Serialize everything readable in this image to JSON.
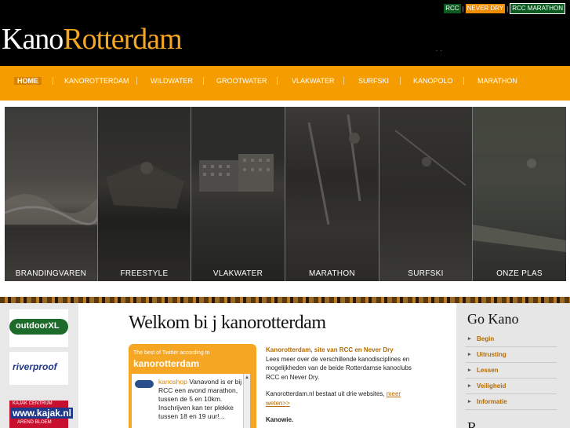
{
  "header": {
    "logo_prefix": "Kano",
    "logo_suffix": "Rotterdam",
    "toplinks": [
      "RCC",
      "NEVER DRY",
      "RCC MARATHON"
    ],
    "toplink_sep": "|"
  },
  "nav": {
    "items": [
      "HOME",
      "KANOROTTERDAM",
      "WILDWATER",
      "GROOTWATER",
      "VLAKWATER",
      "SURFSKI",
      "KANOPOLO",
      "MARATHON"
    ],
    "active": "HOME"
  },
  "gallery": {
    "panels": [
      "BRANDINGVAREN",
      "FREESTYLE",
      "VLAKWATER",
      "MARATHON",
      "SURFSKI",
      "ONZE PLAS"
    ]
  },
  "sponsors": [
    "outdoorXL",
    "riverproof",
    "KAJAK CENTRUM",
    "www.kajak.nl",
    "AREND BLOEM"
  ],
  "main": {
    "welcome": "Welkom bi j kanorotterdam",
    "twitter": {
      "small": "The best of Twitter according to",
      "big": "kanorotterdam",
      "handle": "kanoshop",
      "text": " Vanavond is er bij RCC een avond marathon, tussen de 5 en 10km. Inschrijven kan ter plekke tussen 18 en 19 uur!..."
    },
    "intro": {
      "title": "Kanorotterdam, site van RCC en Never Dry",
      "para1": "Lees meer over de verschillende kanodisciplines en mogelijkheden van de beide Rotterdamse kanoclubs RCC en Never Dry.",
      "para2": "Kanorotterdam.nl bestaat uit drie websites,",
      "link": "meer weten>>",
      "bold": "Kanowie."
    }
  },
  "right": {
    "title": "Go Kano",
    "menu": [
      "Begin",
      "Uitrusting",
      "Lessen",
      "Veiligheid",
      "Informatie"
    ],
    "second_title": "R"
  },
  "colors": {
    "nav_orange": "#f49c00",
    "accent_text": "#b46b00",
    "club_green": "#0b5a1f"
  }
}
